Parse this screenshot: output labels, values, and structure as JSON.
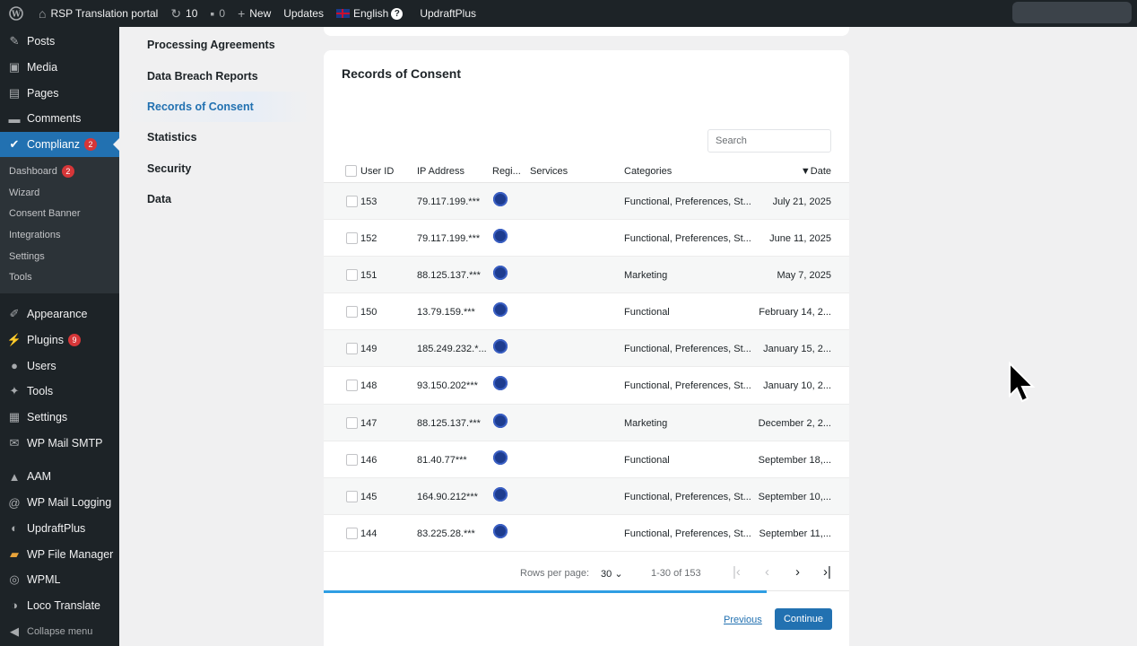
{
  "adminbar": {
    "site_name": "RSP Translation portal",
    "updates_count": "10",
    "comments_count": "0",
    "new_label": "New",
    "updates_label": "Updates",
    "language_label": "English",
    "updraft_label": "UpdraftPlus"
  },
  "menu": {
    "items_top": [
      {
        "label": "Posts",
        "icon": "pin-icon"
      },
      {
        "label": "Media",
        "icon": "media-icon"
      },
      {
        "label": "Pages",
        "icon": "pages-icon"
      },
      {
        "label": "Comments",
        "icon": "comment-icon"
      }
    ],
    "active": {
      "label": "Complianz",
      "badge": "2",
      "icon": "check-icon"
    },
    "submenu": [
      {
        "label": "Dashboard",
        "badge": "2"
      },
      {
        "label": "Wizard"
      },
      {
        "label": "Consent Banner"
      },
      {
        "label": "Integrations"
      },
      {
        "label": "Settings"
      },
      {
        "label": "Tools"
      }
    ],
    "items_mid": [
      {
        "label": "Appearance",
        "icon": "brush-icon"
      },
      {
        "label": "Plugins",
        "icon": "plug-icon",
        "badge": "9"
      },
      {
        "label": "Users",
        "icon": "user-icon"
      },
      {
        "label": "Tools",
        "icon": "wrench-icon"
      },
      {
        "label": "Settings",
        "icon": "settings-icon"
      },
      {
        "label": "WP Mail SMTP",
        "icon": "mail-icon"
      }
    ],
    "items_bottom": [
      {
        "label": "AAM",
        "icon": "aam-icon"
      },
      {
        "label": "WP Mail Logging",
        "icon": "at-icon"
      },
      {
        "label": "UpdraftPlus",
        "icon": "updraft-icon"
      },
      {
        "label": "WP File Manager",
        "icon": "folder-icon"
      },
      {
        "label": "WPML",
        "icon": "wpml-icon"
      },
      {
        "label": "Loco Translate",
        "icon": "translate-icon"
      },
      {
        "label": "Collapse menu",
        "icon": "collapse-icon"
      }
    ]
  },
  "subnav": [
    {
      "label": "Processing Agreements"
    },
    {
      "label": "Data Breach Reports"
    },
    {
      "label": "Records of Consent",
      "active": true
    },
    {
      "label": "Statistics"
    },
    {
      "label": "Security"
    },
    {
      "label": "Data"
    }
  ],
  "records": {
    "title": "Records of Consent",
    "search_placeholder": "Search",
    "columns": {
      "user_id": "User ID",
      "ip": "IP Address",
      "region": "Regi...",
      "services": "Services",
      "categories": "Categories",
      "date": "▼Date"
    },
    "rows": [
      {
        "id": "153",
        "ip": "79.117.199.***",
        "categories": "Functional, Preferences, St...",
        "date": "July 21, 2025"
      },
      {
        "id": "152",
        "ip": "79.117.199.***",
        "categories": "Functional, Preferences, St...",
        "date": "June 11, 2025"
      },
      {
        "id": "151",
        "ip": "88.125.137.***",
        "categories": "Marketing",
        "date": "May 7, 2025"
      },
      {
        "id": "150",
        "ip": "13.79.159.***",
        "categories": "Functional",
        "date": "February 14, 2..."
      },
      {
        "id": "149",
        "ip": "185.249.232.*...",
        "categories": "Functional, Preferences, St...",
        "date": "January 15, 2..."
      },
      {
        "id": "148",
        "ip": "93.150.202***",
        "categories": "Functional, Preferences, St...",
        "date": "January 10, 2..."
      },
      {
        "id": "147",
        "ip": "88.125.137.***",
        "categories": "Marketing",
        "date": "December 2, 2..."
      },
      {
        "id": "146",
        "ip": "81.40.77***",
        "categories": "Functional",
        "date": "September 18,..."
      },
      {
        "id": "145",
        "ip": "164.90.212***",
        "categories": "Functional, Preferences, St...",
        "date": "September 10,..."
      },
      {
        "id": "144",
        "ip": "83.225.28.***",
        "categories": "Functional, Preferences, St...",
        "date": "September 11,..."
      }
    ],
    "pagination": {
      "rows_per_page_label": "Rows per page:",
      "rows_per_page_value": "30",
      "range": "1-30 of 153"
    },
    "progress_fraction": 0.843,
    "previous_label": "Previous",
    "continue_label": "Continue"
  }
}
